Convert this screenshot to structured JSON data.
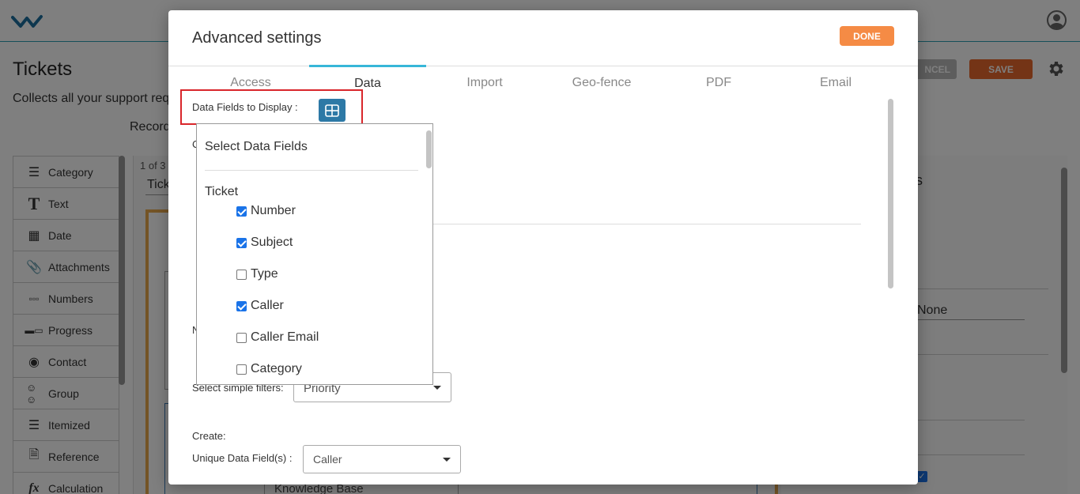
{
  "app": {
    "page_title": "Tickets",
    "page_subtitle": "Collects all your support req",
    "records_label": "Record",
    "cancel_label": "NCEL",
    "save_label": "SAVE",
    "pager": "1 of 3",
    "tab_partial": "Tick",
    "knowledge_base": "Knowledge Base",
    "right_partial": "s",
    "none_option": "None",
    "field_types": [
      {
        "label": "Category",
        "icon": "list-icon"
      },
      {
        "label": "Text",
        "icon": "text-icon"
      },
      {
        "label": "Date",
        "icon": "calendar-icon"
      },
      {
        "label": "Attachments",
        "icon": "paperclip-icon"
      },
      {
        "label": "Numbers",
        "icon": "numbers-icon"
      },
      {
        "label": "Progress",
        "icon": "progress-icon"
      },
      {
        "label": "Contact",
        "icon": "contact-icon"
      },
      {
        "label": "Group",
        "icon": "group-icon"
      },
      {
        "label": "Itemized",
        "icon": "itemized-icon"
      },
      {
        "label": "Reference",
        "icon": "document-icon"
      },
      {
        "label": "Calculation",
        "icon": "fx-icon"
      }
    ]
  },
  "modal": {
    "title": "Advanced settings",
    "done_label": "DONE",
    "tabs": [
      {
        "label": "Access"
      },
      {
        "label": "Data"
      },
      {
        "label": "Import"
      },
      {
        "label": "Geo-fence"
      },
      {
        "label": "PDF"
      },
      {
        "label": "Email"
      }
    ],
    "active_tab": "Data",
    "data_fields_label": "Data Fields to Display :",
    "hidden_c": "C",
    "hidden_n": "N",
    "simple_filters_label": "Select simple filters:",
    "simple_filter_value": "Priority",
    "create_label": "Create:",
    "unique_label": "Unique Data Field(s) :",
    "unique_value": "Caller"
  },
  "dropdown": {
    "header": "Select Data Fields",
    "group": "Ticket",
    "items": [
      {
        "label": "Number",
        "checked": true
      },
      {
        "label": "Subject",
        "checked": true
      },
      {
        "label": "Type",
        "checked": false
      },
      {
        "label": "Caller",
        "checked": true
      },
      {
        "label": "Caller Email",
        "checked": false
      },
      {
        "label": "Category",
        "checked": false
      }
    ]
  },
  "colors": {
    "accent": "#37b6d8",
    "done": "#f58b45",
    "save": "#e8692c",
    "grid_button": "#2d79a6",
    "highlight": "#d9262b",
    "checkbox": "#1a73e8"
  }
}
